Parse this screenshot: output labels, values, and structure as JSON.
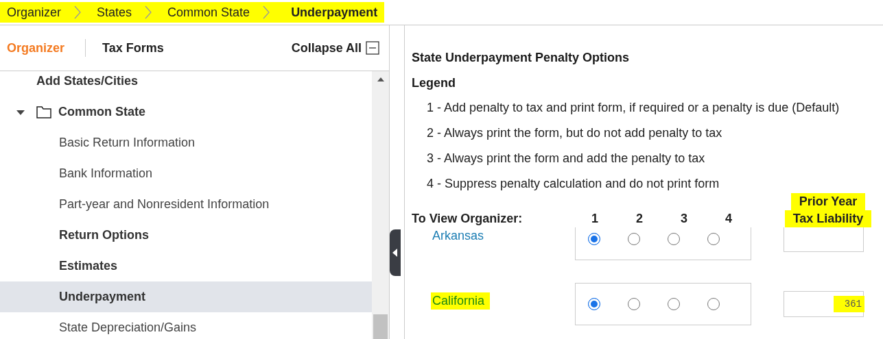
{
  "breadcrumb": {
    "highlighted": true,
    "items": [
      {
        "label": "Organizer",
        "current": false
      },
      {
        "label": "States",
        "current": false
      },
      {
        "label": "Common State",
        "current": false
      },
      {
        "label": "Underpayment",
        "current": true
      }
    ]
  },
  "sidebar": {
    "tabs": [
      {
        "label": "Organizer",
        "selected": true
      },
      {
        "label": "Tax Forms",
        "selected": false
      }
    ],
    "collapse_all": "Collapse All",
    "tree": [
      {
        "label": "Add States/Cities",
        "bold": true,
        "selected": false
      },
      {
        "label": "Common State",
        "bold": true,
        "selected": false,
        "expanded": true,
        "children": [
          {
            "label": "Basic Return Information",
            "bold": false,
            "selected": false
          },
          {
            "label": "Bank Information",
            "bold": false,
            "selected": false
          },
          {
            "label": "Part-year and Nonresident Information",
            "bold": false,
            "selected": false
          },
          {
            "label": "Return Options",
            "bold": true,
            "selected": false
          },
          {
            "label": "Estimates",
            "bold": true,
            "selected": false
          },
          {
            "label": "Underpayment",
            "bold": true,
            "selected": true
          },
          {
            "label": "State Depreciation/Gains",
            "bold": false,
            "selected": false
          }
        ]
      }
    ]
  },
  "main": {
    "title": "State Underpayment Penalty Options",
    "legend_title": "Legend",
    "legend": [
      "1 - Add penalty to tax and print form, if required or a penalty is due (Default)",
      "2 - Always print the form, but do not add penalty to tax",
      "3 - Always print the form and add the penalty to tax",
      "4 - Suppress penalty calculation and do not print form"
    ],
    "header": {
      "label": "To View Organizer:",
      "options": [
        "1",
        "2",
        "3",
        "4"
      ],
      "liability": [
        "Prior Year",
        "Tax Liability"
      ],
      "liability_highlighted": true
    },
    "states": [
      {
        "name": "Arkansas",
        "color": "#1b7db3",
        "highlighted": false,
        "options": [
          {
            "selected": true
          },
          {
            "selected": false
          },
          {
            "selected": false
          },
          {
            "selected": false
          }
        ]
      },
      {
        "name": "California",
        "color": "#1f8a12",
        "highlighted": true,
        "options": [
          {
            "selected": true
          },
          {
            "selected": false
          },
          {
            "selected": false
          },
          {
            "selected": false
          }
        ],
        "value": "361",
        "value_highlighted": true
      }
    ]
  }
}
